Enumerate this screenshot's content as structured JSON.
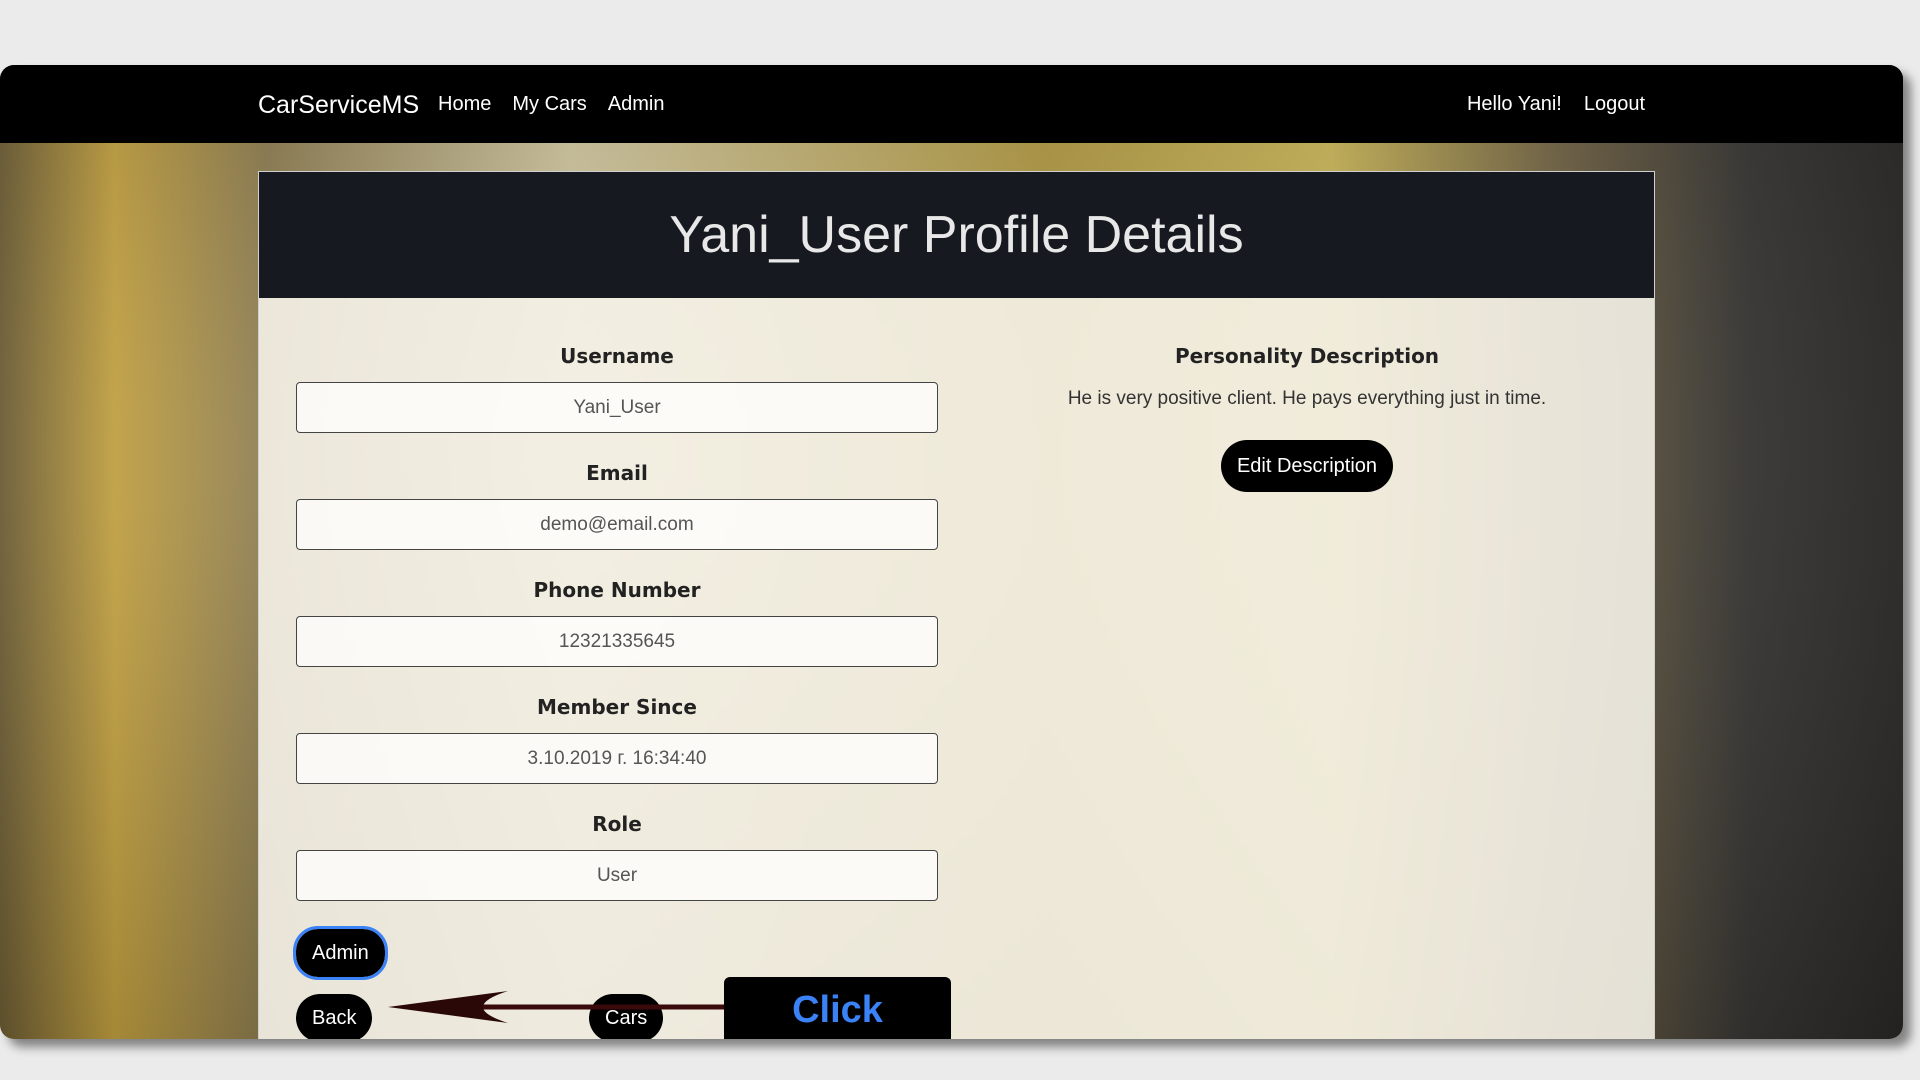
{
  "navbar": {
    "brand": "CarServiceMS",
    "links": [
      "Home",
      "My Cars",
      "Admin"
    ],
    "greeting": "Hello Yani!",
    "logout": "Logout"
  },
  "card": {
    "title": "Yani_User Profile Details"
  },
  "fields": [
    {
      "label": "Username",
      "value": "Yani_User"
    },
    {
      "label": "Email",
      "value": "demo@email.com"
    },
    {
      "label": "Phone Number",
      "value": "12321335645"
    },
    {
      "label": "Member Since",
      "value": "3.10.2019 г. 16:34:40"
    },
    {
      "label": "Role",
      "value": "User"
    }
  ],
  "description": {
    "label": "Personality Description",
    "text": "He is very positive client. He pays everything just in time.",
    "edit_button": "Edit Description"
  },
  "buttons": {
    "admin": "Admin",
    "back": "Back",
    "cars": "Cars"
  },
  "annotation": {
    "text": "Click",
    "color": "#3b82f6"
  }
}
